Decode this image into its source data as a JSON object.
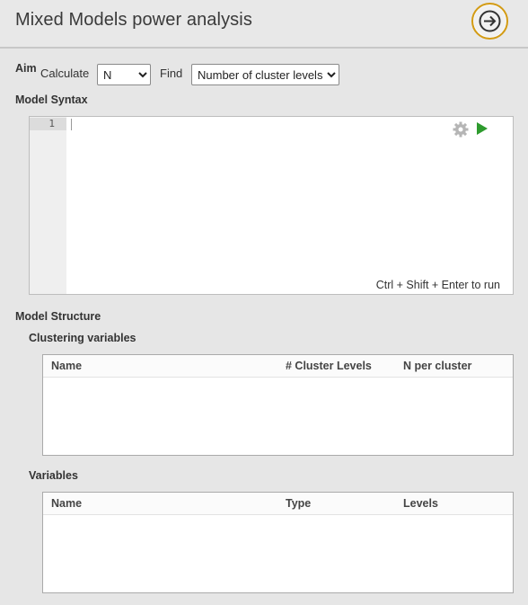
{
  "header": {
    "title": "Mixed Models power analysis"
  },
  "aim": {
    "label": "Aim",
    "calculate_label": "Calculate",
    "calculate_value": "N",
    "find_label": "Find",
    "find_value": "Number of cluster levels"
  },
  "syntax": {
    "label": "Model Syntax",
    "line_number": "1",
    "run_hint": "Ctrl + Shift + Enter to run"
  },
  "structure": {
    "label": "Model Structure",
    "clustering": {
      "label": "Clustering variables",
      "columns": [
        "Name",
        "# Cluster Levels",
        "N per cluster"
      ],
      "rows": []
    },
    "variables": {
      "label": "Variables",
      "columns": [
        "Name",
        "Type",
        "Levels"
      ],
      "rows": []
    }
  },
  "colors": {
    "accent_ring": "#d39b14",
    "run_green": "#2e9b2e",
    "gear_gray": "#b5b5b5"
  },
  "icons": {
    "go": "arrow-right-icon",
    "settings": "gear-icon",
    "run": "play-icon"
  }
}
